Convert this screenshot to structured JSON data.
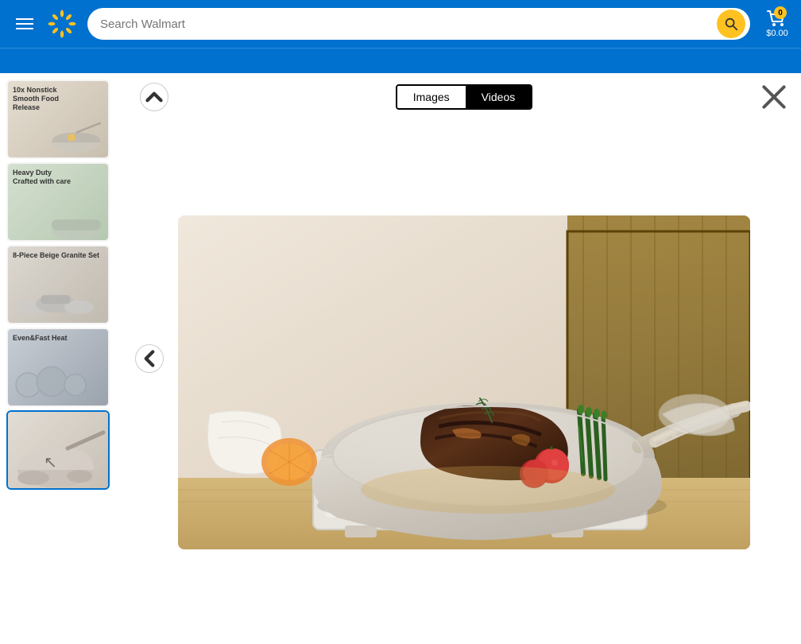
{
  "navbar": {
    "search_placeholder": "Search Walmart",
    "cart_count": "0",
    "cart_total": "$0.00"
  },
  "toolbar": {
    "images_tab": "Images",
    "videos_tab": "Videos"
  },
  "thumbnails": [
    {
      "id": 1,
      "label": "10x Nonstick\nSmooth Food\nRelease",
      "selected": false
    },
    {
      "id": 2,
      "label": "Heavy Duty\nCrafted with care",
      "selected": false
    },
    {
      "id": 3,
      "label": "8-Piece Beige Granite Set",
      "selected": false
    },
    {
      "id": 4,
      "label": "Even&Fast Heat",
      "selected": false
    },
    {
      "id": 5,
      "label": "",
      "selected": true
    }
  ],
  "active_tab": "Videos",
  "main_image_alt": "Beige granite cookware pan with steak, tomatoes and asparagus on stove"
}
